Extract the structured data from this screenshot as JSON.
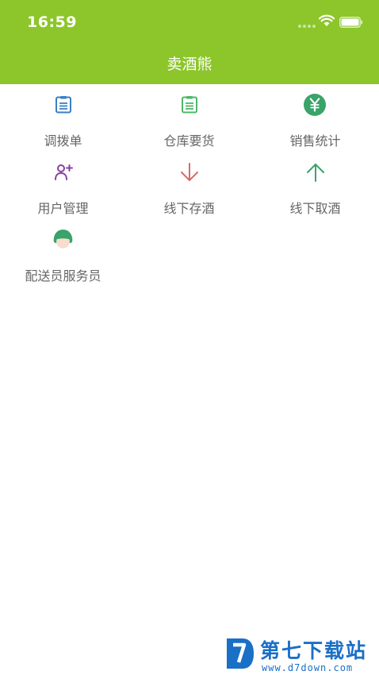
{
  "status_bar": {
    "time": "16:59"
  },
  "nav": {
    "title": "卖酒熊"
  },
  "grid": {
    "items": [
      {
        "label": "调拨单",
        "icon": "document-list-icon",
        "color": "#3b7fc4"
      },
      {
        "label": "仓库要货",
        "icon": "document-list-icon",
        "color": "#4cb86a"
      },
      {
        "label": "销售统计",
        "icon": "yen-circle-icon",
        "color": "#3aa36a"
      },
      {
        "label": "用户管理",
        "icon": "user-add-icon",
        "color": "#8a3fa3"
      },
      {
        "label": "线下存酒",
        "icon": "arrow-down-icon",
        "color": "#d86b6b"
      },
      {
        "label": "线下取酒",
        "icon": "arrow-up-icon",
        "color": "#3aa36a"
      },
      {
        "label": "配送员服务员",
        "icon": "courier-avatar-icon",
        "color": "#3aa36a"
      }
    ]
  },
  "watermark": {
    "brand": "第七下载站",
    "url": "www.d7down.com"
  },
  "colors": {
    "header_bg": "#8cc62a",
    "label_text": "#666666",
    "watermark": "#1a6fc7"
  }
}
